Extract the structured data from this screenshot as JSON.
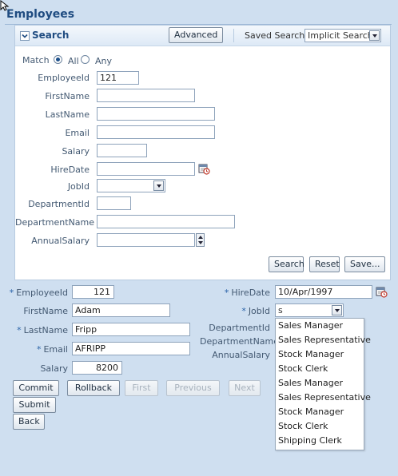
{
  "page": {
    "title": "Employees"
  },
  "search": {
    "title": "Search",
    "advanced_label": "Advanced",
    "saved_search_label": "Saved Search",
    "saved_search_value": "Implicit Search",
    "match_label": "Match",
    "match_all": "All",
    "match_any": "Any",
    "fields": {
      "employee_id": {
        "label": "EmployeeId",
        "value": "121"
      },
      "first_name": {
        "label": "FirstName",
        "value": ""
      },
      "last_name": {
        "label": "LastName",
        "value": ""
      },
      "email": {
        "label": "Email",
        "value": ""
      },
      "salary": {
        "label": "Salary",
        "value": ""
      },
      "hire_date": {
        "label": "HireDate",
        "value": ""
      },
      "job_id": {
        "label": "JobId",
        "value": ""
      },
      "department_id": {
        "label": "DepartmentId",
        "value": ""
      },
      "department_name": {
        "label": "DepartmentName",
        "value": ""
      },
      "annual_salary": {
        "label": "AnnualSalary",
        "value": ""
      }
    },
    "buttons": {
      "search": "Search",
      "reset": "Reset",
      "save": "Save..."
    }
  },
  "form": {
    "employee_id": {
      "label": "EmployeeId",
      "value": "121",
      "required": "*"
    },
    "first_name": {
      "label": "FirstName",
      "value": "Adam"
    },
    "last_name": {
      "label": "LastName",
      "value": "Fripp",
      "required": "*"
    },
    "email": {
      "label": "Email",
      "value": "AFRIPP",
      "required": "*"
    },
    "salary": {
      "label": "Salary",
      "value": "8200"
    },
    "hire_date": {
      "label": "HireDate",
      "value": "10/Apr/1997",
      "required": "*"
    },
    "job_id": {
      "label": "JobId",
      "value": "s",
      "required": "*"
    },
    "department_id": {
      "label": "DepartmentId"
    },
    "department_name": {
      "label": "DepartmentName"
    },
    "annual_salary": {
      "label": "AnnualSalary"
    }
  },
  "job_options": [
    "Sales Manager",
    "Sales Representative",
    "Stock Manager",
    "Stock Clerk",
    "Sales Manager",
    "Sales Representative",
    "Stock Manager",
    "Stock Clerk",
    "Shipping Clerk"
  ],
  "actions": {
    "commit": "Commit",
    "rollback": "Rollback",
    "first": "First",
    "previous": "Previous",
    "next": "Next",
    "submit": "Submit",
    "back": "Back"
  },
  "colors": {
    "panel_bg": "#cfdff0",
    "title": "#1f4c81",
    "required": "#2a63a8"
  },
  "icons": [
    "cursor-icon",
    "chevron-down-icon",
    "calendar-icon",
    "spinner-icon"
  ]
}
